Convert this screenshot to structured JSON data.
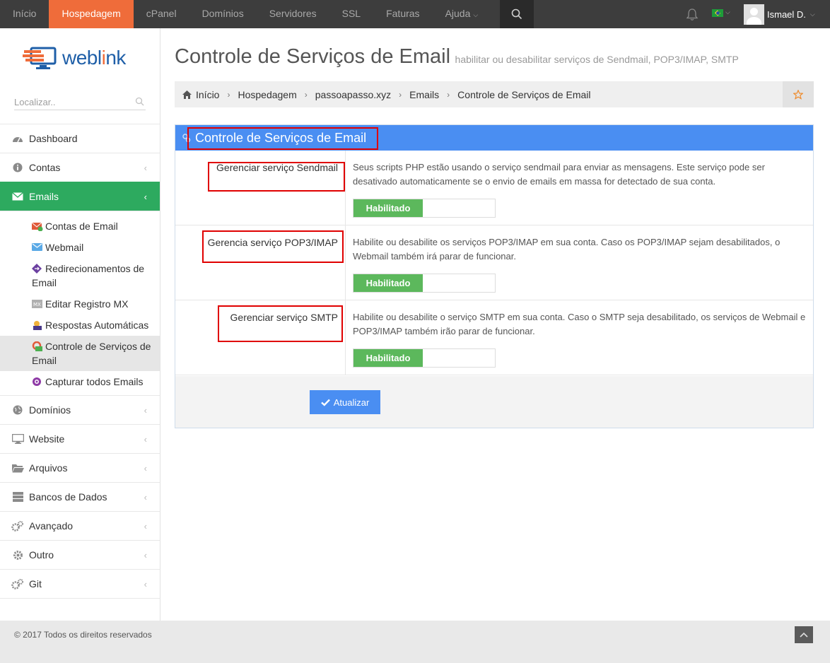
{
  "topnav": {
    "items": [
      "Início",
      "Hospedagem",
      "cPanel",
      "Domínios",
      "Servidores",
      "SSL",
      "Faturas",
      "Ajuda"
    ],
    "active": "Hospedagem"
  },
  "user": {
    "name": "Ismael D."
  },
  "logo": {
    "text_a": "webl",
    "text_b": "i",
    "text_c": "nk"
  },
  "sidebar": {
    "search_placeholder": "Localizar..",
    "items": [
      {
        "label": "Dashboard",
        "icon": "dashboard-icon"
      },
      {
        "label": "Contas",
        "icon": "info-icon"
      },
      {
        "label": "Emails",
        "icon": "envelope-icon"
      },
      {
        "label": "Domínios",
        "icon": "globe-icon"
      },
      {
        "label": "Website",
        "icon": "monitor-icon"
      },
      {
        "label": "Arquivos",
        "icon": "folder-icon"
      },
      {
        "label": "Bancos de Dados",
        "icon": "database-icon"
      },
      {
        "label": "Avançado",
        "icon": "cogs-icon"
      },
      {
        "label": "Outro",
        "icon": "gear-icon"
      },
      {
        "label": "Git",
        "icon": "cogs-icon"
      }
    ],
    "email_subitems": [
      "Contas de Email",
      "Webmail",
      "Redirecionamentos de Email",
      "Editar Registro MX",
      "Respostas Automáticas",
      "Controle de Serviços de Email",
      "Capturar todos Emails"
    ]
  },
  "page": {
    "title": "Controle de Serviços de Email",
    "subtitle": "habilitar ou desabilitar serviços de Sendmail, POP3/IMAP, SMTP"
  },
  "breadcrumb": [
    "Início",
    "Hospedagem",
    "passoapasso.xyz",
    "Emails",
    "Controle de Serviços de Email"
  ],
  "panel": {
    "title": "Controle de Serviços de Email",
    "rows": [
      {
        "label": "Gerenciar serviço Sendmail",
        "description": "Seus scripts PHP estão usando o serviço sendmail para enviar as mensagens. Este serviço pode ser desativado automaticamente se o envio de emails em massa for detectado de sua conta.",
        "status": "Habilitado"
      },
      {
        "label": "Gerencia serviço POP3/IMAP",
        "description": "Habilite ou desabilite os serviços POP3/IMAP em sua conta. Caso os POP3/IMAP sejam desabilitados, o Webmail também irá parar de funcionar.",
        "status": "Habilitado"
      },
      {
        "label": "Gerenciar serviço SMTP",
        "description": "Habilite ou desabilite o serviço SMTP em sua conta. Caso o SMTP seja desabilitado, os serviços de Webmail e POP3/IMAP também irão parar de funcionar.",
        "status": "Habilitado"
      }
    ],
    "update_label": "Atualizar"
  },
  "footer": {
    "copyright": "© 2017 Todos os direitos reservados"
  },
  "colors": {
    "topbar": "#3d3d3d",
    "active_tab": "#ef6c3a",
    "sidebar_active": "#2daa5f",
    "panel_header": "#4a8ef2",
    "toggle_on": "#5cb85c",
    "annotation_red": "#e00000"
  }
}
